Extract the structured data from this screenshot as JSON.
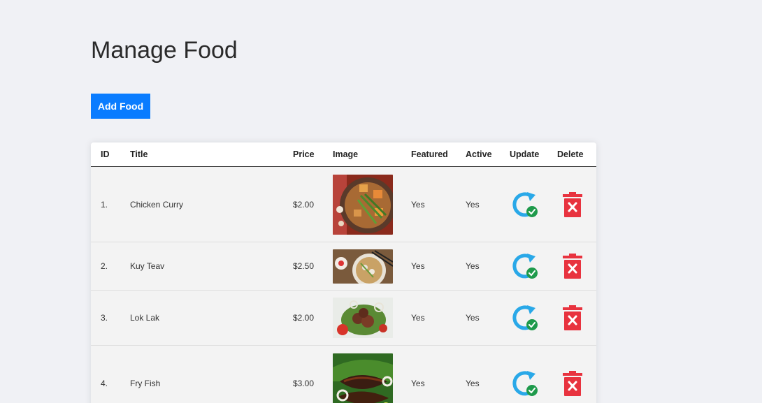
{
  "page": {
    "title": "Manage Food",
    "add_button_label": "Add Food"
  },
  "table": {
    "headers": [
      "ID",
      "Title",
      "Price",
      "Image",
      "Featured",
      "Active",
      "Update",
      "Delete"
    ],
    "rows": [
      {
        "id": "1.",
        "title": "Chicken Curry",
        "price": "$2.00",
        "featured": "Yes",
        "active": "Yes",
        "image": "chicken-curry-photo"
      },
      {
        "id": "2.",
        "title": "Kuy Teav",
        "price": "$2.50",
        "featured": "Yes",
        "active": "Yes",
        "image": "kuy-teav-photo"
      },
      {
        "id": "3.",
        "title": "Lok Lak",
        "price": "$2.00",
        "featured": "Yes",
        "active": "Yes",
        "image": "lok-lak-photo"
      },
      {
        "id": "4.",
        "title": "Fry Fish",
        "price": "$3.00",
        "featured": "Yes",
        "active": "Yes",
        "image": "fry-fish-photo"
      }
    ]
  },
  "icons": {
    "update": "update-icon",
    "delete": "delete-icon"
  },
  "colors": {
    "background": "#f0f1f5",
    "primary_button": "#0a7cff",
    "update_icon": "#29a8e8",
    "check_badge": "#1e9a4b",
    "delete_icon": "#e8333f"
  }
}
